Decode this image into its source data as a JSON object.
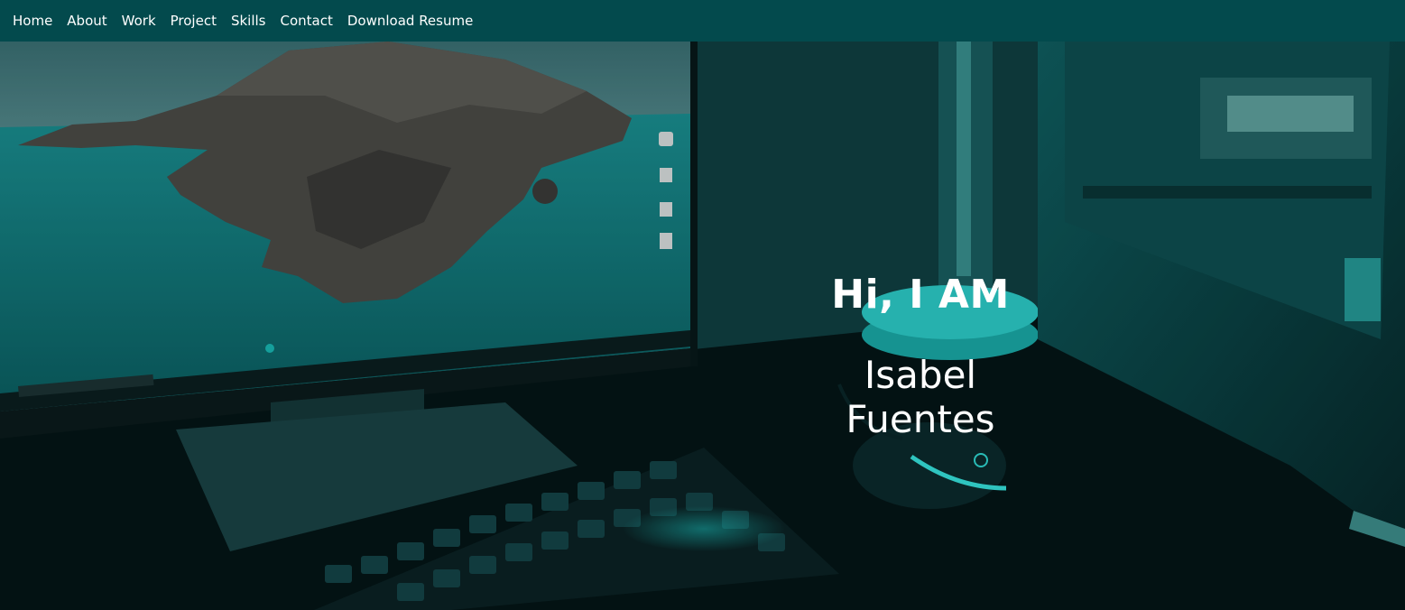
{
  "nav": {
    "items": [
      {
        "label": "Home"
      },
      {
        "label": "About"
      },
      {
        "label": "Work"
      },
      {
        "label": "Project"
      },
      {
        "label": "Skills"
      },
      {
        "label": "Contact"
      },
      {
        "label": "Download Resume"
      }
    ]
  },
  "hero": {
    "greeting": "Hi, I AM",
    "name": "Isabel Fuentes",
    "background_image": "desk-setup-photo"
  },
  "colors": {
    "nav_background": "#034a4d",
    "accent_teal": "#14b8b8",
    "text": "#ffffff"
  }
}
